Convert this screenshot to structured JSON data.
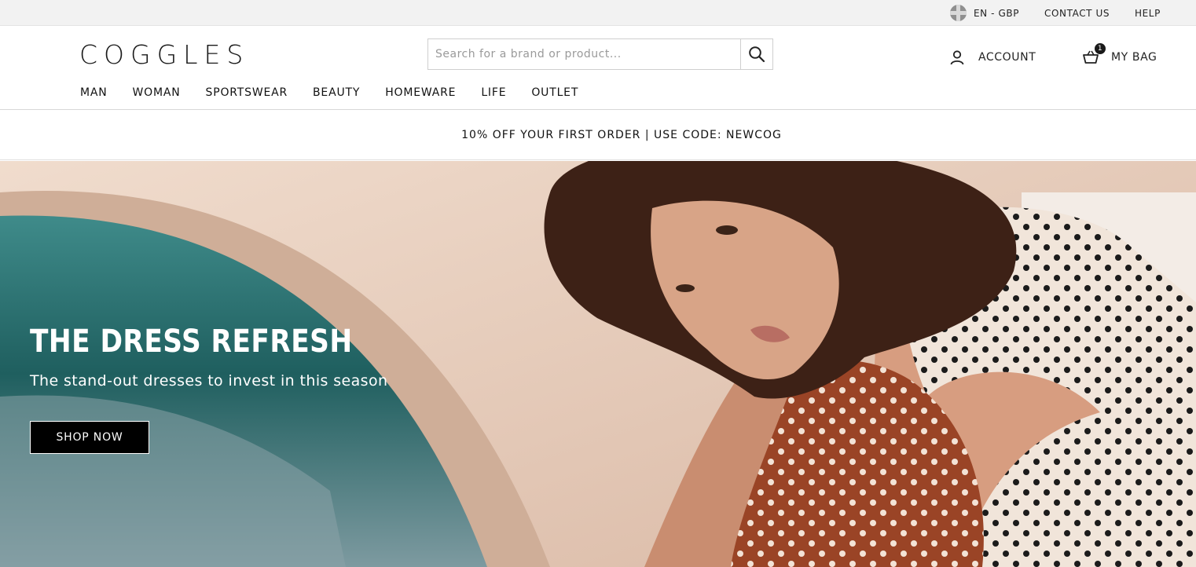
{
  "utility_bar": {
    "locale": "EN - GBP",
    "contact": "CONTACT US",
    "help": "HELP"
  },
  "header": {
    "logo": "COGGLES",
    "search": {
      "placeholder": "Search for a brand or product..."
    },
    "account_label": "ACCOUNT",
    "bag_label": "MY BAG",
    "bag_count": "1"
  },
  "nav": {
    "items": [
      "MAN",
      "WOMAN",
      "SPORTSWEAR",
      "BEAUTY",
      "HOMEWARE",
      "LIFE",
      "OUTLET"
    ]
  },
  "promo": {
    "text": "10% OFF YOUR FIRST ORDER | USE CODE: NEWCOG"
  },
  "hero": {
    "title": "THE DRESS REFRESH",
    "subtitle": "The stand-out dresses to invest in this season",
    "cta": "SHOP NOW"
  },
  "colors": {
    "utility_bg": "#f2f2f2",
    "text": "#111111",
    "button_bg": "#000000"
  },
  "icons": [
    "uk-flag-icon",
    "search-icon",
    "user-icon",
    "basket-icon"
  ]
}
